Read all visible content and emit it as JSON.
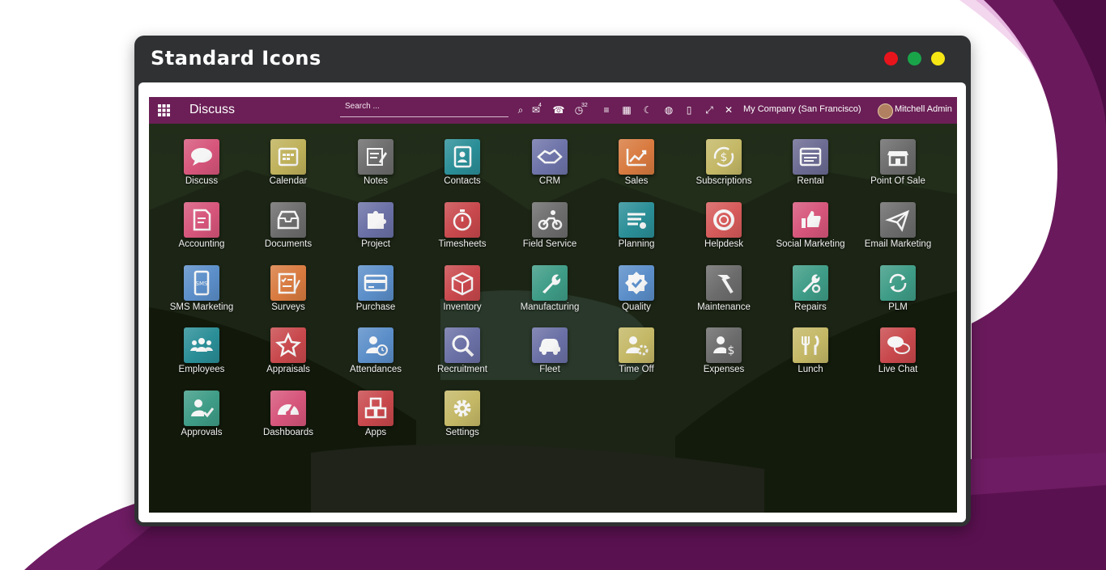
{
  "window": {
    "title": "Standard Icons",
    "dot_colors": [
      "#e8141c",
      "#1aa44a",
      "#f5e614"
    ]
  },
  "navbar": {
    "app_name": "Discuss",
    "search_placeholder": "Search ...",
    "icons": [
      {
        "name": "search-icon",
        "glyph": "⌕",
        "badge": ""
      },
      {
        "name": "chat-icon",
        "glyph": "✉",
        "badge": "4"
      },
      {
        "name": "phone-icon",
        "glyph": "☎",
        "badge": ""
      },
      {
        "name": "activity-icon",
        "glyph": "◷",
        "badge": "32"
      },
      {
        "name": "list-icon",
        "glyph": "≡",
        "badge": ""
      },
      {
        "name": "calculator-icon",
        "glyph": "▦",
        "badge": ""
      },
      {
        "name": "dark-mode-icon",
        "glyph": "☾",
        "badge": ""
      },
      {
        "name": "globe-icon",
        "glyph": "◍",
        "badge": ""
      },
      {
        "name": "bookmark-icon",
        "glyph": "▯",
        "badge": ""
      },
      {
        "name": "expand-icon",
        "glyph": "⤢",
        "badge": ""
      },
      {
        "name": "close-icon",
        "glyph": "✕",
        "badge": ""
      }
    ],
    "company": "My Company (San Francisco)",
    "user": "Mitchell Admin"
  },
  "apps": [
    {
      "label": "Discuss",
      "icon": "chat-bubble-icon",
      "color": "#d6557a"
    },
    {
      "label": "Calendar",
      "icon": "calendar-icon",
      "color": "#bfb15a"
    },
    {
      "label": "Notes",
      "icon": "notes-icon",
      "color": "#6c6c6c"
    },
    {
      "label": "Contacts",
      "icon": "address-book-icon",
      "color": "#2a8e97"
    },
    {
      "label": "CRM",
      "icon": "handshake-icon",
      "color": "#6d73a8"
    },
    {
      "label": "Sales",
      "icon": "chart-up-icon",
      "color": "#d87a3f"
    },
    {
      "label": "Subscriptions",
      "icon": "dollar-cycle-icon",
      "color": "#c4b866"
    },
    {
      "label": "Rental",
      "icon": "rental-icon",
      "color": "#6b6a92"
    },
    {
      "label": "Point Of Sale",
      "icon": "store-icon",
      "color": "#6b6b6b"
    },
    {
      "label": "Accounting",
      "icon": "invoice-icon",
      "color": "#d6557a"
    },
    {
      "label": "Documents",
      "icon": "inbox-icon",
      "color": "#6c6c6c"
    },
    {
      "label": "Project",
      "icon": "puzzle-icon",
      "color": "#6a70a5"
    },
    {
      "label": "Timesheets",
      "icon": "stopwatch-icon",
      "color": "#c8484c"
    },
    {
      "label": "Field Service",
      "icon": "motorbike-icon",
      "color": "#6c6c6c"
    },
    {
      "label": "Planning",
      "icon": "planning-icon",
      "color": "#2a8e97"
    },
    {
      "label": "Helpdesk",
      "icon": "lifebuoy-icon",
      "color": "#d65a5a"
    },
    {
      "label": "Social Marketing",
      "icon": "thumbs-up-icon",
      "color": "#d6557a"
    },
    {
      "label": "Email Marketing",
      "icon": "paper-plane-icon",
      "color": "#6b6b6b"
    },
    {
      "label": "SMS Marketing",
      "icon": "sms-phone-icon",
      "color": "#5b8ec9"
    },
    {
      "label": "Surveys",
      "icon": "survey-icon",
      "color": "#d87a3f"
    },
    {
      "label": "Purchase",
      "icon": "credit-card-icon",
      "color": "#5b8ec9"
    },
    {
      "label": "Inventory",
      "icon": "box-icon",
      "color": "#c8484c"
    },
    {
      "label": "Manufacturing",
      "icon": "wrench-icon",
      "color": "#3e9c86"
    },
    {
      "label": "Quality",
      "icon": "quality-badge-icon",
      "color": "#5b8ec9"
    },
    {
      "label": "Maintenance",
      "icon": "hammer-icon",
      "color": "#6b6b6b"
    },
    {
      "label": "Repairs",
      "icon": "repair-tools-icon",
      "color": "#3e9c86"
    },
    {
      "label": "PLM",
      "icon": "cycle-icon",
      "color": "#3e9c86"
    },
    {
      "label": "Employees",
      "icon": "people-icon",
      "color": "#2a8e97"
    },
    {
      "label": "Appraisals",
      "icon": "star-icon",
      "color": "#c8484c"
    },
    {
      "label": "Attendances",
      "icon": "user-clock-icon",
      "color": "#5b8ec9"
    },
    {
      "label": "Recruitment",
      "icon": "magnifier-icon",
      "color": "#6a70a5"
    },
    {
      "label": "Fleet",
      "icon": "car-icon",
      "color": "#6a70a5"
    },
    {
      "label": "Time Off",
      "icon": "user-gear-icon",
      "color": "#c4b866"
    },
    {
      "label": "Expenses",
      "icon": "user-dollar-icon",
      "color": "#6b6b6b"
    },
    {
      "label": "Lunch",
      "icon": "cutlery-icon",
      "color": "#c4b866"
    },
    {
      "label": "Live Chat",
      "icon": "chat-bubbles-icon",
      "color": "#c8484c"
    },
    {
      "label": "Approvals",
      "icon": "user-check-icon",
      "color": "#3e9c86"
    },
    {
      "label": "Dashboards",
      "icon": "gauge-icon",
      "color": "#d6557a"
    },
    {
      "label": "Apps",
      "icon": "cubes-icon",
      "color": "#c8484c"
    },
    {
      "label": "Settings",
      "icon": "gear-icon",
      "color": "#c4b866"
    }
  ]
}
